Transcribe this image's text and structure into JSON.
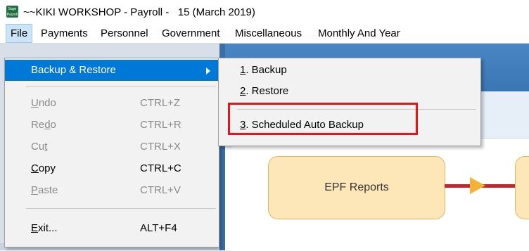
{
  "window": {
    "icon_text_top": "Sage",
    "icon_text_bottom": "Payroll",
    "title": "~~KIKI WORKSHOP - Payroll -   15 (March 2019)"
  },
  "menubar": {
    "items": [
      "File",
      "Payments",
      "Personnel",
      "Government",
      "Miscellaneous",
      "Monthly And Year"
    ]
  },
  "file_menu": {
    "backup_restore": "Backup & Restore",
    "undo": {
      "pre": "",
      "u": "U",
      "post": "ndo",
      "shortcut": "CTRL+Z"
    },
    "redo": {
      "pre": "Re",
      "u": "d",
      "post": "o",
      "shortcut": "CTRL+R"
    },
    "cut": {
      "pre": "Cu",
      "u": "t",
      "post": "",
      "shortcut": "CTRL+X"
    },
    "copy": {
      "pre": "",
      "u": "C",
      "post": "opy",
      "shortcut": "CTRL+C"
    },
    "paste": {
      "pre": "",
      "u": "P",
      "post": "aste",
      "shortcut": "CTRL+V"
    },
    "exit": {
      "pre": "",
      "u": "E",
      "post": "xit...",
      "shortcut": "ALT+F4"
    }
  },
  "sub_menu": {
    "backup": {
      "u": "1",
      "post": ". Backup"
    },
    "restore": {
      "u": "2",
      "post": ". Restore"
    },
    "scheduled": {
      "u": "3",
      "post": ". Scheduled Auto Backup"
    }
  },
  "workflow": {
    "epf_reports": "EPF Reports"
  },
  "colors": {
    "menu_highlight": "#0078d7",
    "annotation_red": "#e8141c",
    "box_fill": "#fde7b8"
  }
}
